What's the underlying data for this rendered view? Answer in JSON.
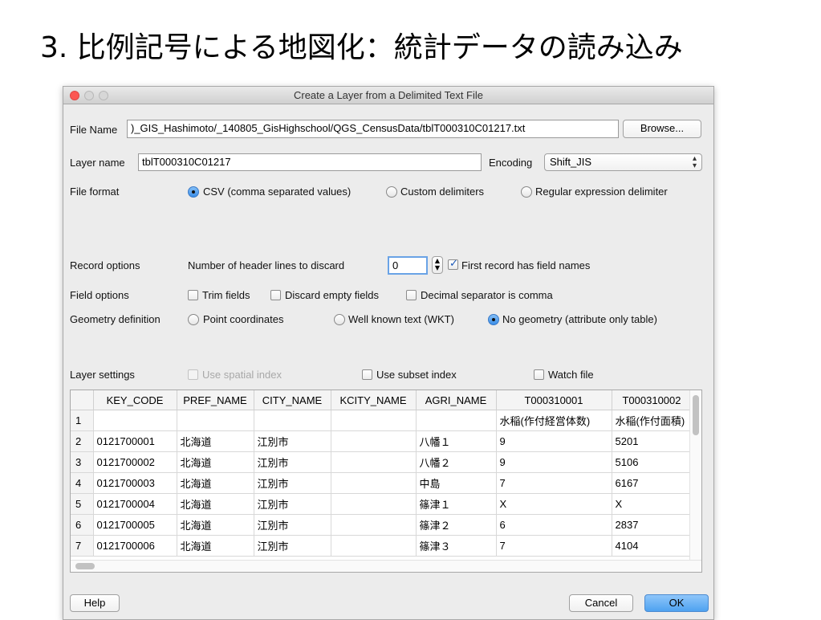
{
  "slide_title": "3. 比例記号による地図化：統計データの読み込み",
  "window": {
    "title": "Create a Layer from a Delimited Text File"
  },
  "file_name": {
    "label": "File Name",
    "value": ")_GIS_Hashimoto/_140805_GisHighschool/QGS_CensusData/tblT000310C01217.txt",
    "browse_label": "Browse..."
  },
  "layer_name": {
    "label": "Layer name",
    "value": "tblT000310C01217"
  },
  "encoding": {
    "label": "Encoding",
    "value": "Shift_JIS"
  },
  "file_format": {
    "label": "File format",
    "options": [
      {
        "label": "CSV (comma separated values)",
        "selected": true
      },
      {
        "label": "Custom delimiters",
        "selected": false
      },
      {
        "label": "Regular expression delimiter",
        "selected": false
      }
    ]
  },
  "record_options": {
    "label": "Record options",
    "header_lines_label": "Number of header lines to discard",
    "header_lines_value": "0",
    "first_record_label": "First record has field names",
    "first_record_checked": true
  },
  "field_options": {
    "label": "Field options",
    "trim_label": "Trim fields",
    "discard_label": "Discard empty fields",
    "decimal_label": "Decimal separator is comma"
  },
  "geometry": {
    "label": "Geometry definition",
    "options": [
      {
        "label": "Point coordinates",
        "selected": false
      },
      {
        "label": "Well known text (WKT)",
        "selected": false
      },
      {
        "label": "No geometry (attribute only table)",
        "selected": true
      }
    ]
  },
  "layer_settings": {
    "label": "Layer settings",
    "spatial_label": "Use spatial index",
    "subset_label": "Use subset index",
    "watch_label": "Watch file"
  },
  "table": {
    "columns": [
      "KEY_CODE",
      "PREF_NAME",
      "CITY_NAME",
      "KCITY_NAME",
      "AGRI_NAME",
      "T000310001",
      "T000310002"
    ],
    "rows": [
      {
        "num": "1",
        "cells": [
          "",
          "",
          "",
          "",
          "",
          "水稲(作付経営体数)",
          "水稲(作付面積)"
        ]
      },
      {
        "num": "2",
        "cells": [
          "0121700001",
          "北海道",
          "江別市",
          "",
          "八幡１",
          "9",
          "5201"
        ]
      },
      {
        "num": "3",
        "cells": [
          "0121700002",
          "北海道",
          "江別市",
          "",
          "八幡２",
          "9",
          "5106"
        ]
      },
      {
        "num": "4",
        "cells": [
          "0121700003",
          "北海道",
          "江別市",
          "",
          "中島",
          "7",
          "6167"
        ]
      },
      {
        "num": "5",
        "cells": [
          "0121700004",
          "北海道",
          "江別市",
          "",
          "篠津１",
          "X",
          "X"
        ]
      },
      {
        "num": "6",
        "cells": [
          "0121700005",
          "北海道",
          "江別市",
          "",
          "篠津２",
          "6",
          "2837"
        ]
      },
      {
        "num": "7",
        "cells": [
          "0121700006",
          "北海道",
          "江別市",
          "",
          "篠津３",
          "7",
          "4104"
        ]
      }
    ]
  },
  "buttons": {
    "help": "Help",
    "cancel": "Cancel",
    "ok": "OK"
  }
}
